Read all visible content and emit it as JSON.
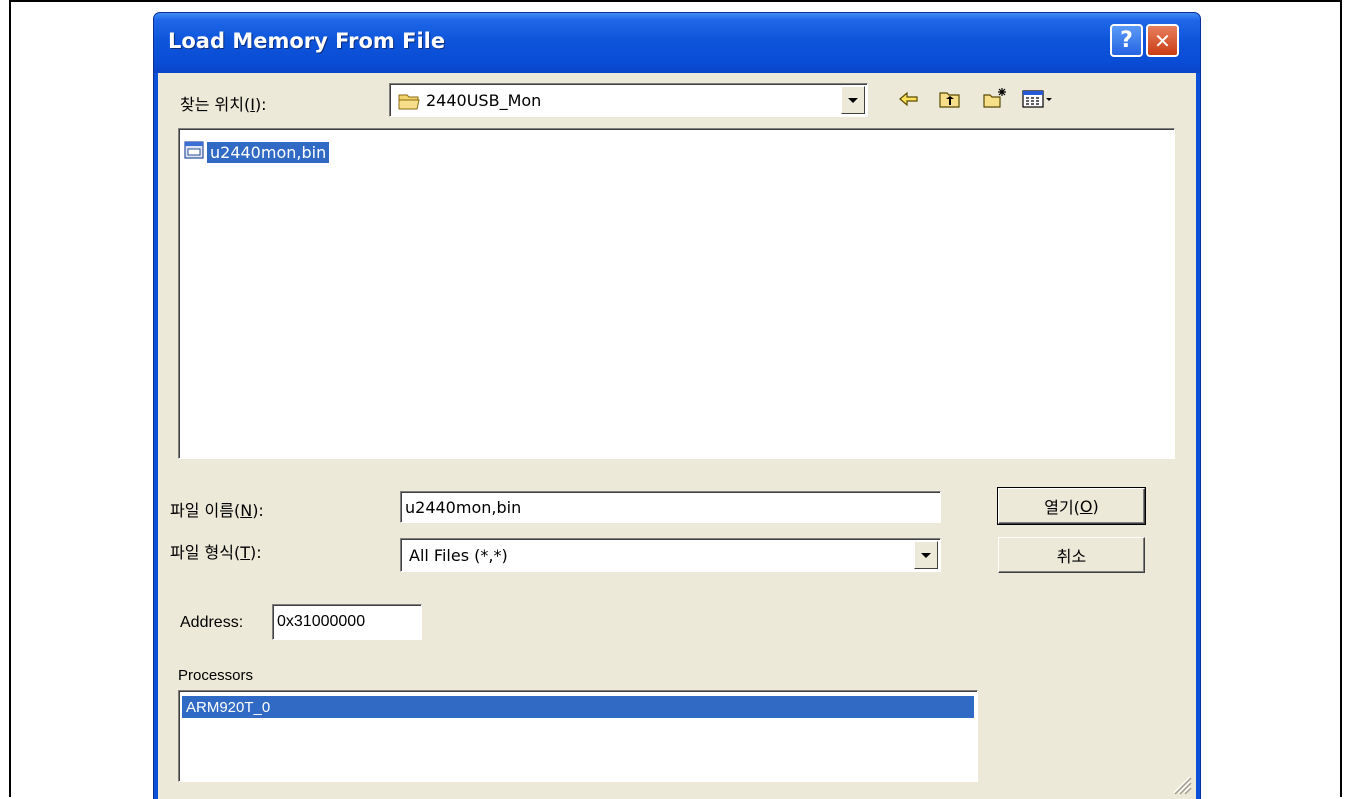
{
  "dialog": {
    "title": "Load Memory From File",
    "help_glyph": "?",
    "close_glyph": "✕"
  },
  "look_in": {
    "label_prefix": "찾는 위치(",
    "label_key": "I",
    "label_suffix": "):",
    "value": "2440USB_Mon"
  },
  "toolbar": {
    "back_icon": "back-arrow-icon",
    "up_icon": "up-folder-icon",
    "new_folder_icon": "new-folder-icon",
    "views_icon": "views-menu-icon"
  },
  "files": [
    {
      "name": "u2440mon,bin",
      "icon": "binary-file-icon",
      "selected": true
    }
  ],
  "file_name": {
    "label_prefix": "파일 이름(",
    "label_key": "N",
    "label_suffix": "):",
    "value": "u2440mon,bin"
  },
  "file_type": {
    "label_prefix": "파일 형식(",
    "label_key": "T",
    "label_suffix": "):",
    "value": "All Files (*,*)"
  },
  "buttons": {
    "open_prefix": "열기(",
    "open_key": "O",
    "open_suffix": ")",
    "cancel": "취소"
  },
  "address": {
    "label": "Address:",
    "value": "0x31000000"
  },
  "processors": {
    "label": "Processors",
    "items": [
      "ARM920T_0"
    ]
  },
  "colors": {
    "titlebar": "#0a4dd6",
    "face": "#ece9d8",
    "selection": "#316ac5"
  }
}
